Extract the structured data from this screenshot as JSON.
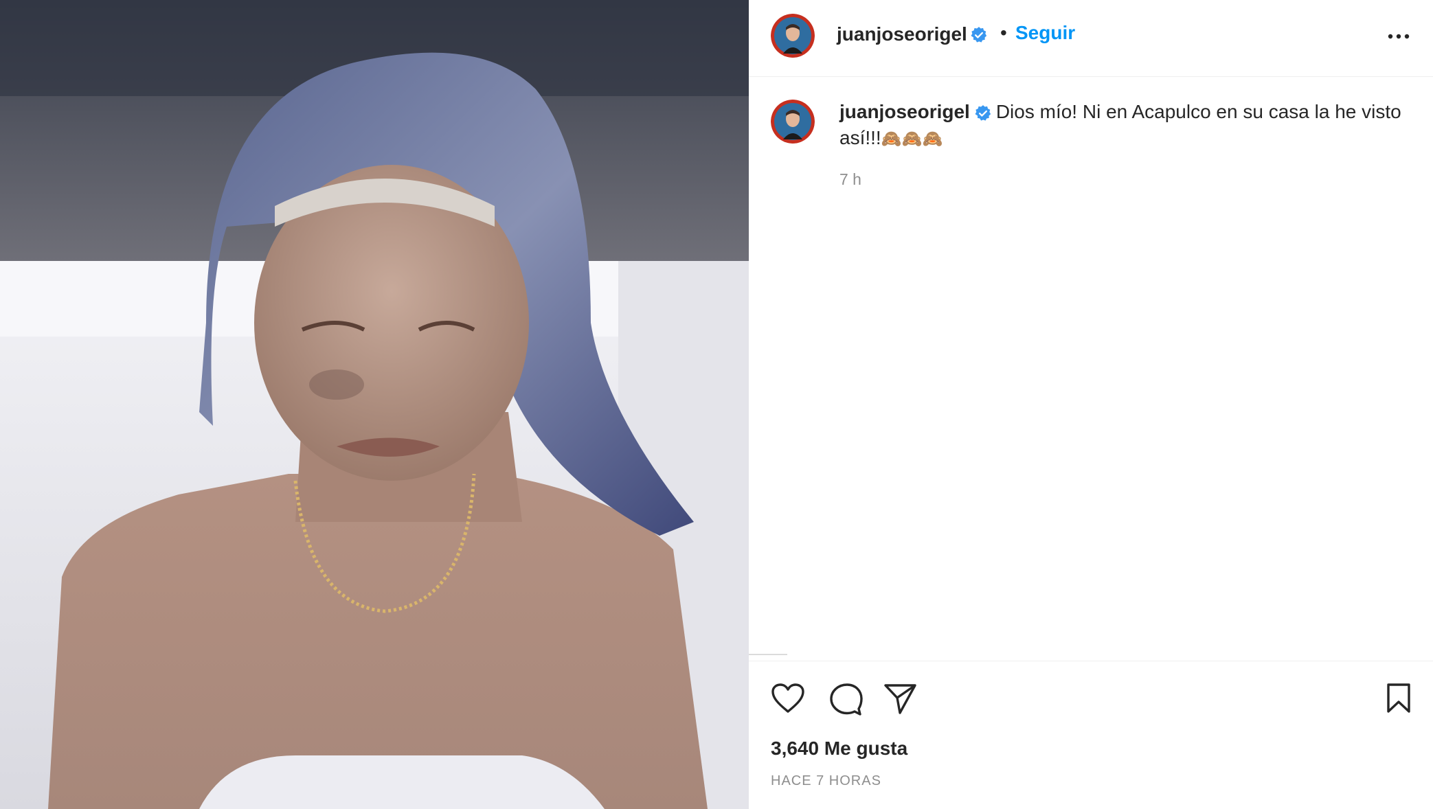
{
  "post": {
    "image_description_icon": "photo"
  },
  "header": {
    "username": "juanjoseorigel",
    "separator": "•",
    "follow_label": "Seguir",
    "more_icon": "more-horizontal-icon"
  },
  "caption": {
    "username": "juanjoseorigel",
    "text": "Dios mío! Ni en Acapulco en su casa la he visto así!!!",
    "emojis": "🙈🙈🙈",
    "time": "7 h"
  },
  "actions": {
    "like_icon": "heart-icon",
    "comment_icon": "comment-icon",
    "share_icon": "send-icon",
    "save_icon": "bookmark-icon"
  },
  "stats": {
    "likes": "3,640 Me gusta",
    "posted": "HACE 7 HORAS"
  },
  "colors": {
    "link_blue": "#0095f6",
    "verified_blue": "#3897f0",
    "secondary_text": "#8e8e8e"
  }
}
